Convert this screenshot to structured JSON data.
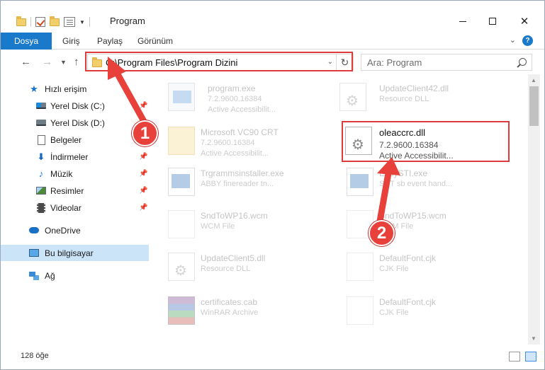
{
  "window": {
    "title": "Program"
  },
  "ribbon": {
    "tabs": [
      "Dosya",
      "Giriş",
      "Paylaş",
      "Görünüm"
    ]
  },
  "nav": {
    "address": "C:\\Program Files\\Program Dizini",
    "search_placeholder": "Ara: Program"
  },
  "sidebar": {
    "items": [
      {
        "label": "Hızlı erişim",
        "icon": "star-icon"
      },
      {
        "label": "Yerel Disk (C:)",
        "icon": "drive-icon",
        "pinned": true
      },
      {
        "label": "Yerel Disk (D:)",
        "icon": "drive-icon"
      },
      {
        "label": "Belgeler",
        "icon": "documents-icon"
      },
      {
        "label": "İndirmeler",
        "icon": "downloads-icon",
        "pinned": true
      },
      {
        "label": "Müzik",
        "icon": "music-icon",
        "pinned": true
      },
      {
        "label": "Resimler",
        "icon": "pictures-icon",
        "pinned": true
      },
      {
        "label": "Videolar",
        "icon": "videos-icon",
        "pinned": true
      },
      {
        "label": "OneDrive",
        "icon": "onedrive-icon"
      },
      {
        "label": "Bu bilgisayar",
        "icon": "this-pc-icon",
        "selected": true
      },
      {
        "label": "Ağ",
        "icon": "network-icon"
      }
    ]
  },
  "files": [
    {
      "name": "program.exe",
      "version": "7.2.9600.16384",
      "desc": "Active Accessibilit...",
      "icon": "exe-icon"
    },
    {
      "name": "UpdateClient42.dll",
      "version": "Resource DLL",
      "desc": "",
      "icon": "dll-icon"
    },
    {
      "name": "Microsoft VC90 CRT",
      "version": "7.2.9600.16384",
      "desc": "Active Accessibilit...",
      "icon": "folder-icon"
    },
    {
      "name": "oleaccrc.dll",
      "version": "7.2.9600.16384",
      "desc": "Active Accessibilit...",
      "icon": "dll-icon"
    },
    {
      "name": "Trgrammsinstaller.exe",
      "version": "ABBY finereader tn...",
      "desc": "",
      "icon": "exe-icon"
    },
    {
      "name": "EasySTI.exe",
      "version": "SNT sb event hand...",
      "desc": "",
      "icon": "exe-icon"
    },
    {
      "name": "SndToWP16.wcm",
      "version": "WCM File",
      "desc": "",
      "icon": "blank-file-icon"
    },
    {
      "name": "SndToWP15.wcm",
      "version": "WCM File",
      "desc": "",
      "icon": "blank-file-icon"
    },
    {
      "name": "UpdateClient5.dll",
      "version": "Resource DLL",
      "desc": "",
      "icon": "dll-icon"
    },
    {
      "name": "DefaultFont.cjk",
      "version": "CJK File",
      "desc": "",
      "icon": "blank-file-icon"
    },
    {
      "name": "certificates.cab",
      "version": "WinRAR Archive",
      "desc": "",
      "icon": "archive-icon"
    },
    {
      "name": "DefaultFont.cjk",
      "version": "CJK File",
      "desc": "",
      "icon": "blank-file-icon"
    }
  ],
  "status": {
    "item_count": "128 öğe"
  },
  "annotations": {
    "step1": "1",
    "step2": "2"
  },
  "colors": {
    "accent": "#1979ca",
    "highlight": "#e03b3b",
    "selection": "#cce4f7"
  }
}
